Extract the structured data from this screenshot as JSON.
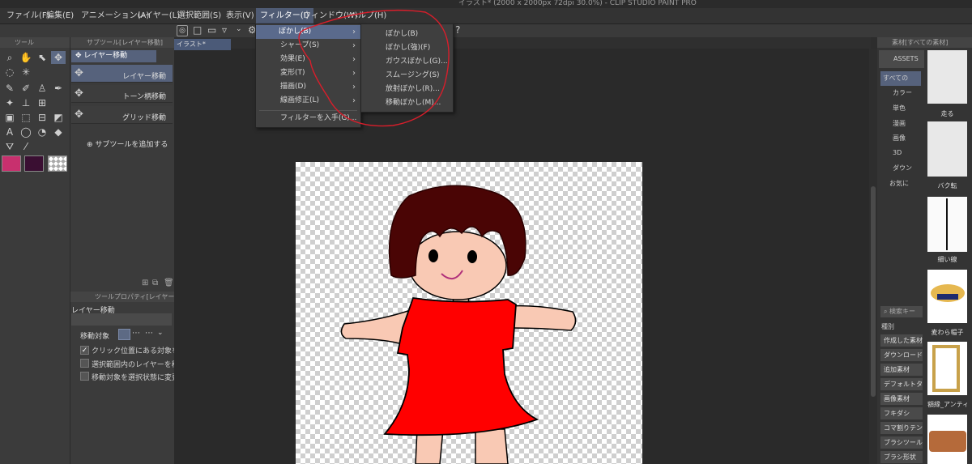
{
  "window": {
    "title": "イラスト* (2000 x 2000px 72dpi 30.0%) - CLIP STUDIO PAINT PRO"
  },
  "menubar": {
    "items": [
      "ファイル(F)",
      "編集(E)",
      "アニメーション(A)",
      "レイヤー(L)",
      "選択範囲(S)",
      "表示(V)",
      "フィルター(I)",
      "ウィンドウ(W)",
      "ヘルプ(H)"
    ],
    "active": "フィルター(I)"
  },
  "tool_panel": {
    "header": "ツール"
  },
  "subtool_panel": {
    "header": "サブツール[レイヤー移動]",
    "group": "レイヤー移動",
    "items": [
      "レイヤー移動",
      "トーン柄移動",
      "グリッド移動"
    ],
    "add_label": "サブツールを追加する"
  },
  "tool_property": {
    "header": "ツールプロパティ[レイヤー移動]",
    "title": "レイヤー移動",
    "target_label": "移動対象",
    "checks": [
      {
        "label": "クリック位置にある対象を移動",
        "checked": true
      },
      {
        "label": "選択範囲内のレイヤーを移動",
        "checked": false
      },
      {
        "label": "移動対象を選択状態に変更",
        "checked": false
      }
    ]
  },
  "colors": {
    "main": "#c8306e",
    "sub": "#3a0f32",
    "canvas_bg": "#2a2a2a",
    "menu_highlight": "#5a6a8c"
  },
  "document_tab": "イラスト*",
  "filter_menu": {
    "items": [
      "ぼかし(B)",
      "シャープ(S)",
      "効果(E)",
      "変形(T)",
      "描画(D)",
      "線画修正(L)"
    ],
    "extra": "フィルターを入手(G)..."
  },
  "blur_submenu": {
    "items": [
      "ぼかし(B)",
      "ぼかし(強)(F)",
      "ガウスぼかし(G)...",
      "スムージング(S)",
      "放射ぼかし(R)...",
      "移動ぼかし(M)..."
    ]
  },
  "materials_panel": {
    "header": "素材[すべての素材]",
    "assets_label": "ASSETS",
    "tree": [
      "すべての",
      "カラー",
      "単色",
      "漫画",
      "画像",
      "3D",
      "ダウン",
      "お気に"
    ],
    "search_placeholder": "検索キー",
    "kind_label": "種別",
    "buttons": [
      "作成した素材",
      "ダウンロード",
      "追加素材",
      "デフォルトタ",
      "画像素材",
      "フキダシ",
      "コマ割りテン",
      "ブラシツール",
      "ブラシ形状"
    ],
    "thumbs": [
      "走る",
      "バク転",
      "細い線",
      "麦わら帽子",
      "額縁_アンティー"
    ]
  }
}
